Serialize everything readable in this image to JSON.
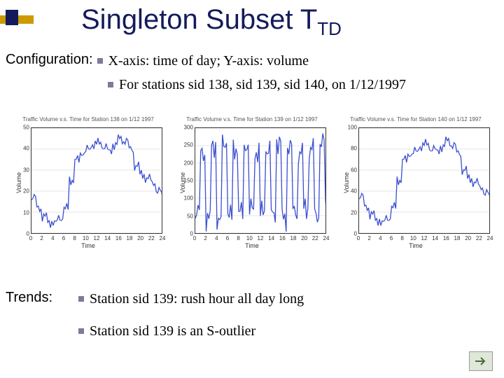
{
  "title_main": "Singleton Subset T",
  "title_sub": "TD",
  "config_label": "Configuration:",
  "config_bullet1": "X-axis: time of day; Y-axis: volume",
  "config_bullet2": "For stations sid 138, sid 139, sid 140, on 1/12/1997",
  "trends_label": "Trends:",
  "trend_bullet1": "Station sid 139: rush hour all day long",
  "trend_bullet2": "Station sid 139 is an S-outlier",
  "charts_common": {
    "xlabel": "Time",
    "ylabel": "Volume",
    "x_ticks": [
      0,
      2,
      4,
      6,
      8,
      10,
      12,
      14,
      16,
      18,
      20,
      22,
      24
    ],
    "x_range": [
      0,
      24
    ]
  },
  "chart_data": [
    {
      "type": "line",
      "title": "Traffic Volume v.s. Time for Station 138 on 1/12 1997",
      "ylabel": "Volume",
      "xlabel": "Time",
      "ylim": [
        0,
        50
      ],
      "y_ticks": [
        0,
        10,
        20,
        30,
        40,
        50
      ],
      "x": [
        0,
        1,
        2,
        3,
        4,
        5,
        6,
        7,
        8,
        9,
        10,
        11,
        12,
        13,
        14,
        15,
        16,
        17,
        18,
        19,
        20,
        21,
        22,
        23,
        24
      ],
      "values": [
        17,
        12,
        8,
        5,
        5,
        7,
        12,
        25,
        35,
        38,
        40,
        42,
        43,
        41,
        39,
        42,
        45,
        44,
        40,
        32,
        28,
        26,
        24,
        20,
        17
      ]
    },
    {
      "type": "line",
      "title": "Traffic Volume v.s. Time for Station 139 on 1/12 1997",
      "ylabel": "Volume",
      "xlabel": "Time",
      "ylim": [
        0,
        300
      ],
      "y_ticks": [
        0,
        50,
        100,
        150,
        200,
        250,
        300
      ],
      "x": [
        0,
        1,
        2,
        3,
        4,
        5,
        6,
        7,
        8,
        9,
        10,
        11,
        12,
        13,
        14,
        15,
        16,
        17,
        18,
        19,
        20,
        21,
        22,
        23,
        24
      ],
      "values": [
        60,
        230,
        40,
        250,
        30,
        260,
        50,
        240,
        60,
        250,
        70,
        230,
        60,
        240,
        50,
        260,
        40,
        250,
        60,
        230,
        70,
        240,
        50,
        260,
        60
      ]
    },
    {
      "type": "line",
      "title": "Traffic Volume v.s. Time for Station 140 on 1/12 1997",
      "ylabel": "Volume",
      "xlabel": "Time",
      "ylim": [
        0,
        100
      ],
      "y_ticks": [
        0,
        20,
        40,
        60,
        80,
        100
      ],
      "x": [
        0,
        1,
        2,
        3,
        4,
        5,
        6,
        7,
        8,
        9,
        10,
        11,
        12,
        13,
        14,
        15,
        16,
        17,
        18,
        19,
        20,
        21,
        22,
        23,
        24
      ],
      "values": [
        35,
        25,
        18,
        12,
        10,
        14,
        25,
        50,
        70,
        75,
        78,
        82,
        85,
        80,
        78,
        82,
        88,
        84,
        76,
        60,
        52,
        48,
        44,
        38,
        32
      ]
    }
  ],
  "colors": {
    "line": "#3a4fcf",
    "title_color": "#141b5a",
    "bullet_square": "#7e7a9c"
  }
}
